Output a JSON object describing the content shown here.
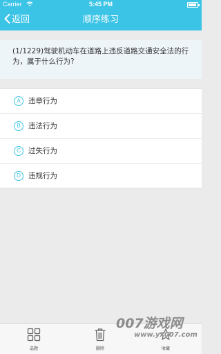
{
  "status_bar": {
    "carrier": "Carrier",
    "wifi_icon": "wifi-icon",
    "time": "5:45 PM",
    "battery_icon": "battery-icon"
  },
  "nav": {
    "back_icon": "chevron-left-icon",
    "back_label": "返回",
    "title": "顺序练习"
  },
  "question": {
    "text": "(1/1229)驾驶机动车在道路上违反道路交通安全法的行为，属于什么行为?"
  },
  "options": [
    {
      "letter": "A",
      "text": "违章行为"
    },
    {
      "letter": "B",
      "text": "违法行为"
    },
    {
      "letter": "C",
      "text": "过失行为"
    },
    {
      "letter": "D",
      "text": "违规行为"
    }
  ],
  "tabbar": {
    "items": [
      {
        "label": "选题",
        "icon": "grid-icon"
      },
      {
        "label": "删除",
        "icon": "trash-icon"
      },
      {
        "label": "收藏",
        "icon": "star-icon"
      }
    ]
  },
  "watermark": {
    "line1": "007游戏网",
    "line2": "www.yx007.com"
  },
  "colors": {
    "accent": "#3cc4e6",
    "background": "#ebebeb",
    "question_bg": "#eef5f9"
  }
}
